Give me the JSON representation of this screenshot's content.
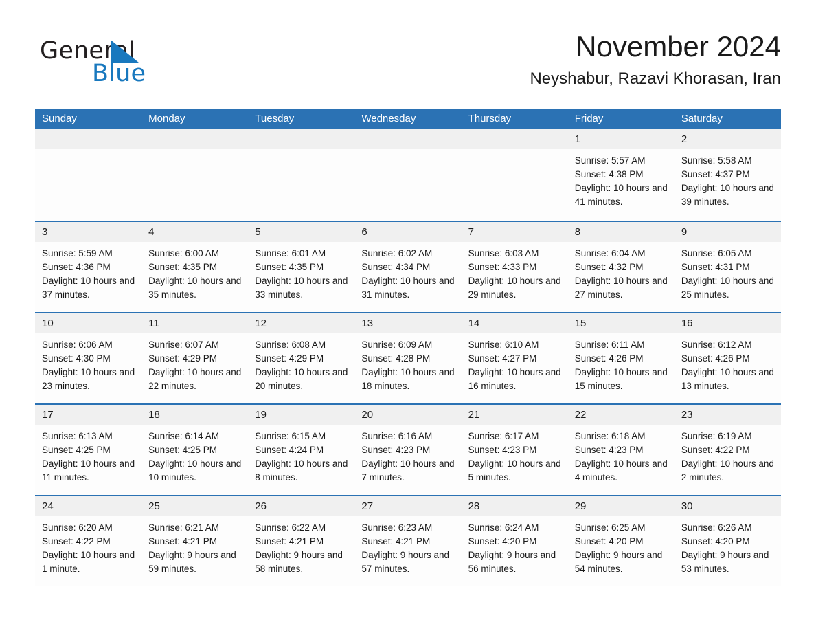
{
  "brand": {
    "word_one": "General",
    "word_two": "Blue",
    "triangle_color": "#1878be",
    "text_color": "#231f20"
  },
  "header": {
    "month_title": "November 2024",
    "location": "Neyshabur, Razavi Khorasan, Iran"
  },
  "theme": {
    "header_blue": "#2b72b4",
    "daynum_gray": "#f0f0f0",
    "cell_white": "#fdfdfd",
    "text_black": "#1a1a1a"
  },
  "calendar": {
    "weekday_headers": [
      "Sunday",
      "Monday",
      "Tuesday",
      "Wednesday",
      "Thursday",
      "Friday",
      "Saturday"
    ],
    "weeks": [
      [
        {
          "day": "",
          "sunrise": "",
          "sunset": "",
          "daylight": ""
        },
        {
          "day": "",
          "sunrise": "",
          "sunset": "",
          "daylight": ""
        },
        {
          "day": "",
          "sunrise": "",
          "sunset": "",
          "daylight": ""
        },
        {
          "day": "",
          "sunrise": "",
          "sunset": "",
          "daylight": ""
        },
        {
          "day": "",
          "sunrise": "",
          "sunset": "",
          "daylight": ""
        },
        {
          "day": "1",
          "sunrise": "Sunrise: 5:57 AM",
          "sunset": "Sunset: 4:38 PM",
          "daylight": "Daylight: 10 hours and 41 minutes."
        },
        {
          "day": "2",
          "sunrise": "Sunrise: 5:58 AM",
          "sunset": "Sunset: 4:37 PM",
          "daylight": "Daylight: 10 hours and 39 minutes."
        }
      ],
      [
        {
          "day": "3",
          "sunrise": "Sunrise: 5:59 AM",
          "sunset": "Sunset: 4:36 PM",
          "daylight": "Daylight: 10 hours and 37 minutes."
        },
        {
          "day": "4",
          "sunrise": "Sunrise: 6:00 AM",
          "sunset": "Sunset: 4:35 PM",
          "daylight": "Daylight: 10 hours and 35 minutes."
        },
        {
          "day": "5",
          "sunrise": "Sunrise: 6:01 AM",
          "sunset": "Sunset: 4:35 PM",
          "daylight": "Daylight: 10 hours and 33 minutes."
        },
        {
          "day": "6",
          "sunrise": "Sunrise: 6:02 AM",
          "sunset": "Sunset: 4:34 PM",
          "daylight": "Daylight: 10 hours and 31 minutes."
        },
        {
          "day": "7",
          "sunrise": "Sunrise: 6:03 AM",
          "sunset": "Sunset: 4:33 PM",
          "daylight": "Daylight: 10 hours and 29 minutes."
        },
        {
          "day": "8",
          "sunrise": "Sunrise: 6:04 AM",
          "sunset": "Sunset: 4:32 PM",
          "daylight": "Daylight: 10 hours and 27 minutes."
        },
        {
          "day": "9",
          "sunrise": "Sunrise: 6:05 AM",
          "sunset": "Sunset: 4:31 PM",
          "daylight": "Daylight: 10 hours and 25 minutes."
        }
      ],
      [
        {
          "day": "10",
          "sunrise": "Sunrise: 6:06 AM",
          "sunset": "Sunset: 4:30 PM",
          "daylight": "Daylight: 10 hours and 23 minutes."
        },
        {
          "day": "11",
          "sunrise": "Sunrise: 6:07 AM",
          "sunset": "Sunset: 4:29 PM",
          "daylight": "Daylight: 10 hours and 22 minutes."
        },
        {
          "day": "12",
          "sunrise": "Sunrise: 6:08 AM",
          "sunset": "Sunset: 4:29 PM",
          "daylight": "Daylight: 10 hours and 20 minutes."
        },
        {
          "day": "13",
          "sunrise": "Sunrise: 6:09 AM",
          "sunset": "Sunset: 4:28 PM",
          "daylight": "Daylight: 10 hours and 18 minutes."
        },
        {
          "day": "14",
          "sunrise": "Sunrise: 6:10 AM",
          "sunset": "Sunset: 4:27 PM",
          "daylight": "Daylight: 10 hours and 16 minutes."
        },
        {
          "day": "15",
          "sunrise": "Sunrise: 6:11 AM",
          "sunset": "Sunset: 4:26 PM",
          "daylight": "Daylight: 10 hours and 15 minutes."
        },
        {
          "day": "16",
          "sunrise": "Sunrise: 6:12 AM",
          "sunset": "Sunset: 4:26 PM",
          "daylight": "Daylight: 10 hours and 13 minutes."
        }
      ],
      [
        {
          "day": "17",
          "sunrise": "Sunrise: 6:13 AM",
          "sunset": "Sunset: 4:25 PM",
          "daylight": "Daylight: 10 hours and 11 minutes."
        },
        {
          "day": "18",
          "sunrise": "Sunrise: 6:14 AM",
          "sunset": "Sunset: 4:25 PM",
          "daylight": "Daylight: 10 hours and 10 minutes."
        },
        {
          "day": "19",
          "sunrise": "Sunrise: 6:15 AM",
          "sunset": "Sunset: 4:24 PM",
          "daylight": "Daylight: 10 hours and 8 minutes."
        },
        {
          "day": "20",
          "sunrise": "Sunrise: 6:16 AM",
          "sunset": "Sunset: 4:23 PM",
          "daylight": "Daylight: 10 hours and 7 minutes."
        },
        {
          "day": "21",
          "sunrise": "Sunrise: 6:17 AM",
          "sunset": "Sunset: 4:23 PM",
          "daylight": "Daylight: 10 hours and 5 minutes."
        },
        {
          "day": "22",
          "sunrise": "Sunrise: 6:18 AM",
          "sunset": "Sunset: 4:23 PM",
          "daylight": "Daylight: 10 hours and 4 minutes."
        },
        {
          "day": "23",
          "sunrise": "Sunrise: 6:19 AM",
          "sunset": "Sunset: 4:22 PM",
          "daylight": "Daylight: 10 hours and 2 minutes."
        }
      ],
      [
        {
          "day": "24",
          "sunrise": "Sunrise: 6:20 AM",
          "sunset": "Sunset: 4:22 PM",
          "daylight": "Daylight: 10 hours and 1 minute."
        },
        {
          "day": "25",
          "sunrise": "Sunrise: 6:21 AM",
          "sunset": "Sunset: 4:21 PM",
          "daylight": "Daylight: 9 hours and 59 minutes."
        },
        {
          "day": "26",
          "sunrise": "Sunrise: 6:22 AM",
          "sunset": "Sunset: 4:21 PM",
          "daylight": "Daylight: 9 hours and 58 minutes."
        },
        {
          "day": "27",
          "sunrise": "Sunrise: 6:23 AM",
          "sunset": "Sunset: 4:21 PM",
          "daylight": "Daylight: 9 hours and 57 minutes."
        },
        {
          "day": "28",
          "sunrise": "Sunrise: 6:24 AM",
          "sunset": "Sunset: 4:20 PM",
          "daylight": "Daylight: 9 hours and 56 minutes."
        },
        {
          "day": "29",
          "sunrise": "Sunrise: 6:25 AM",
          "sunset": "Sunset: 4:20 PM",
          "daylight": "Daylight: 9 hours and 54 minutes."
        },
        {
          "day": "30",
          "sunrise": "Sunrise: 6:26 AM",
          "sunset": "Sunset: 4:20 PM",
          "daylight": "Daylight: 9 hours and 53 minutes."
        }
      ]
    ]
  }
}
